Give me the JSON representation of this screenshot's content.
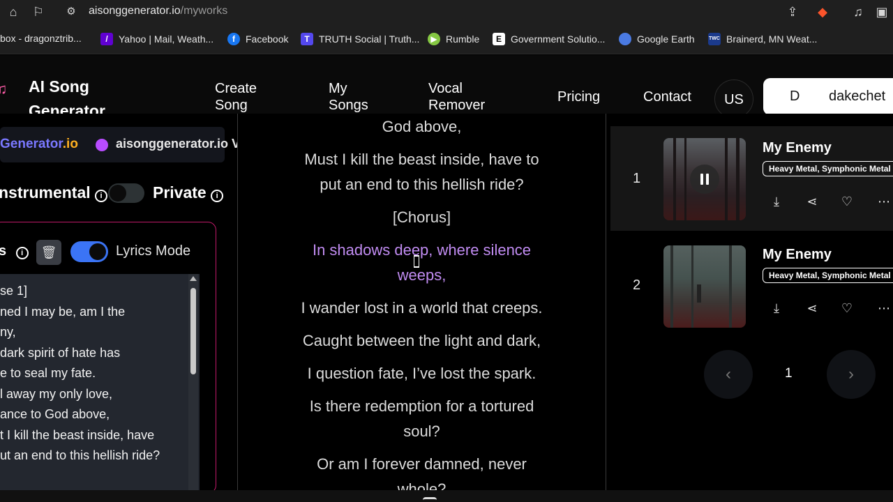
{
  "browser": {
    "url_host": "aisonggenerator.io",
    "url_path": "/myworks",
    "bookmarks": [
      {
        "label": "box - dragonztrib...",
        "icon": "inbox-icon",
        "color": "#1f1f1f"
      },
      {
        "label": "Yahoo | Mail, Weath...",
        "icon": "yahoo-icon",
        "color": "#6001d2"
      },
      {
        "label": "Facebook",
        "icon": "facebook-icon",
        "color": "#1877f2"
      },
      {
        "label": "TRUTH Social | Truth...",
        "icon": "truth-social-icon",
        "color": "#5448ee"
      },
      {
        "label": "Rumble",
        "icon": "rumble-icon",
        "color": "#85c742"
      },
      {
        "label": "Government Solutio...",
        "icon": "e-icon",
        "color": "#ffffff"
      },
      {
        "label": "Google Earth",
        "icon": "globe-icon",
        "color": "#4a7ae2"
      },
      {
        "label": "Brainerd, MN Weat...",
        "icon": "weather-channel-icon",
        "color": "#1b3a8c"
      }
    ]
  },
  "header": {
    "logo_text": "AI Song Generator",
    "nav": [
      "Create Song",
      "My Songs",
      "Vocal Remover",
      "Pricing",
      "Contact"
    ],
    "lang": "US",
    "avatar_letter": "D",
    "username": "dakechet"
  },
  "left": {
    "brand_name": "Generator",
    "brand_suffix": ".io",
    "brand_site": "aisonggenerator.io V",
    "instrumental_label": "nstrumental",
    "private_label": "Private",
    "lyrics_label": "s",
    "lyrics_mode_label": "Lyrics Mode",
    "lyrics_lines": [
      "se 1]",
      "ned I may be, am I the",
      "ny,",
      "dark spirit of hate has",
      "e to seal my fate.",
      "l away my only love,",
      "ance to God above,",
      "t I kill the beast inside, have",
      "ut an end to this hellish ride?"
    ]
  },
  "center": {
    "lines": [
      {
        "text": "God above,",
        "highlight": false
      },
      {
        "text": "Must I kill the beast inside, have to",
        "highlight": false
      },
      {
        "text": "put an end to this hellish ride?",
        "highlight": false
      },
      {
        "text": "[Chorus]",
        "highlight": false
      },
      {
        "text": "In shadows deep, where silence",
        "highlight": true
      },
      {
        "text": "weeps,",
        "highlight": true
      },
      {
        "text": "I wander lost in a world that creeps.",
        "highlight": false
      },
      {
        "text": "Caught between the light and dark,",
        "highlight": false
      },
      {
        "text": "I question fate, I’ve lost the spark.",
        "highlight": false
      },
      {
        "text": "Is there redemption for a tortured",
        "highlight": false
      },
      {
        "text": "soul?",
        "highlight": false
      },
      {
        "text": "Or am I forever damned, never",
        "highlight": false
      },
      {
        "text": "whole?",
        "highlight": false
      }
    ]
  },
  "songs": [
    {
      "index": "1",
      "title": "My Enemy",
      "genre": "Heavy Metal, Symphonic Metal",
      "playing": true
    },
    {
      "index": "2",
      "title": "My Enemy",
      "genre": "Heavy Metal, Symphonic Metal",
      "playing": false
    }
  ],
  "pager": {
    "page": "1",
    "prev_icon": "chevron-left-icon",
    "next_icon": "chevron-right-icon"
  },
  "colors": {
    "accent_purple": "#c18cf2",
    "toggle_on": "#3b74f5",
    "lyrics_border": "#c21a6a"
  }
}
